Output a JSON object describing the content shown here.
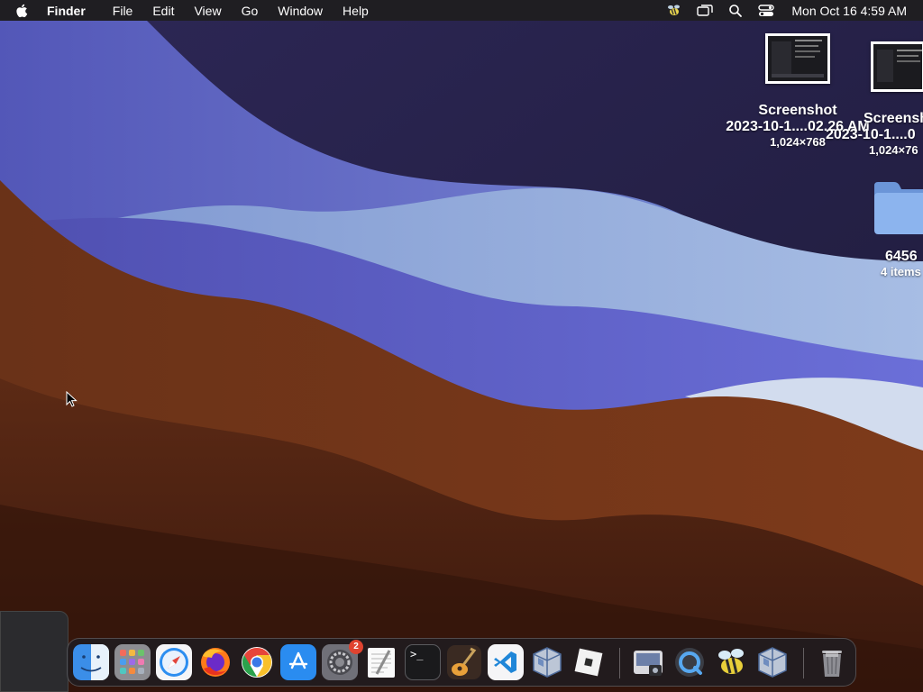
{
  "menubar": {
    "app_name": "Finder",
    "items": [
      "File",
      "Edit",
      "View",
      "Go",
      "Window",
      "Help"
    ],
    "clock": "Mon Oct 16  4:59 AM",
    "status_icons": [
      "bee-icon",
      "screen-mirroring-icon",
      "spotlight-search-icon",
      "control-center-icon"
    ]
  },
  "desktop": {
    "items": [
      {
        "name": "Screenshot",
        "name2": "2023-10-1....02.26 AM",
        "sub": "1,024×768"
      },
      {
        "name": "Screensh",
        "name2": "2023-10-1....0",
        "sub": "1,024×76"
      },
      {
        "name": "6456",
        "sub": "4 items"
      }
    ]
  },
  "dock": {
    "apps": [
      {
        "name": "Finder",
        "icon": "finder-icon"
      },
      {
        "name": "Launchpad",
        "icon": "launchpad-icon"
      },
      {
        "name": "Safari",
        "icon": "safari-icon"
      },
      {
        "name": "Firefox",
        "icon": "firefox-icon"
      },
      {
        "name": "Google Chrome",
        "icon": "chrome-icon"
      },
      {
        "name": "App Store",
        "icon": "app-store-icon"
      },
      {
        "name": "System Settings",
        "icon": "system-settings-icon",
        "badge": "2"
      },
      {
        "name": "TextEdit",
        "icon": "textedit-icon"
      },
      {
        "name": "Terminal",
        "icon": "terminal-icon",
        "text": ">_"
      },
      {
        "name": "GarageBand",
        "icon": "garageband-icon"
      },
      {
        "name": "Visual Studio Code",
        "icon": "vscode-icon"
      },
      {
        "name": "VirtualBox",
        "icon": "virtualbox-icon"
      },
      {
        "name": "Roblox",
        "icon": "roblox-icon"
      },
      {
        "name": "Preview",
        "icon": "preview-icon"
      },
      {
        "name": "QuickTime",
        "icon": "quicktime-icon"
      },
      {
        "name": "Cyberduck",
        "icon": "bee-icon"
      },
      {
        "name": "VirtualBox VM",
        "icon": "virtualbox-icon"
      },
      {
        "name": "Trash",
        "icon": "trash-icon"
      }
    ]
  },
  "colors": {
    "menubar_bg": "#1f1e22",
    "wallpaper_dark_purple": "#252046",
    "wallpaper_blue": "#5b5fc4",
    "wallpaper_lightblue": "#8fa6d6",
    "wallpaper_brown": "#6b3117",
    "wallpaper_dark_brown": "#3a170d"
  }
}
